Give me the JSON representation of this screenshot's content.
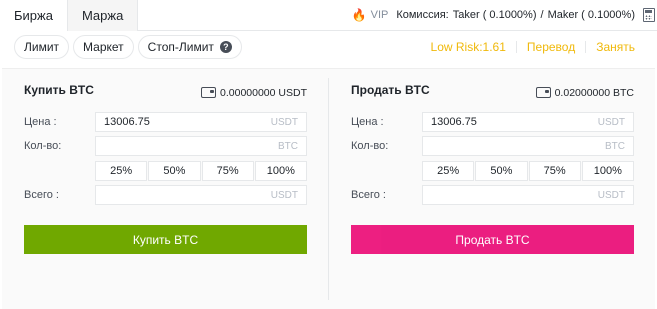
{
  "tabs": [
    {
      "label": "Биржа",
      "active": false
    },
    {
      "label": "Маржа",
      "active": true
    }
  ],
  "fees": {
    "vip": "VIP",
    "commission_label": "Комиссия:",
    "taker": "Taker ( 0.1000%)",
    "divider": "/",
    "maker": "Maker ( 0.1000%)"
  },
  "order_types": [
    "Лимит",
    "Маркет",
    "Стоп-Лимит"
  ],
  "right_links": {
    "risk": "Low Risk:1.61",
    "transfer": "Перевод",
    "borrow": "Занять"
  },
  "buy": {
    "title": "Купить BTC",
    "balance": "0.00000000 USDT",
    "price_label": "Цена :",
    "price_value": "13006.75",
    "price_unit": "USDT",
    "qty_label": "Кол-во:",
    "qty_value": "",
    "qty_unit": "BTC",
    "percents": [
      "25%",
      "50%",
      "75%",
      "100%"
    ],
    "total_label": "Всего :",
    "total_value": "",
    "total_unit": "USDT",
    "button": "Купить BTC"
  },
  "sell": {
    "title": "Продать BTC",
    "balance": "0.02000000 BTC",
    "price_label": "Цена :",
    "price_value": "13006.75",
    "price_unit": "USDT",
    "qty_label": "Кол-во:",
    "qty_value": "",
    "qty_unit": "BTC",
    "percents": [
      "25%",
      "50%",
      "75%",
      "100%"
    ],
    "total_label": "Всего :",
    "total_value": "",
    "total_unit": "USDT",
    "button": "Продать BTC"
  },
  "colors": {
    "accent": "#f0b90b",
    "buy": "#70a800",
    "sell": "#ea0070"
  },
  "icons": [
    "fire-icon",
    "calculator-icon",
    "info-icon",
    "wallet-icon"
  ]
}
